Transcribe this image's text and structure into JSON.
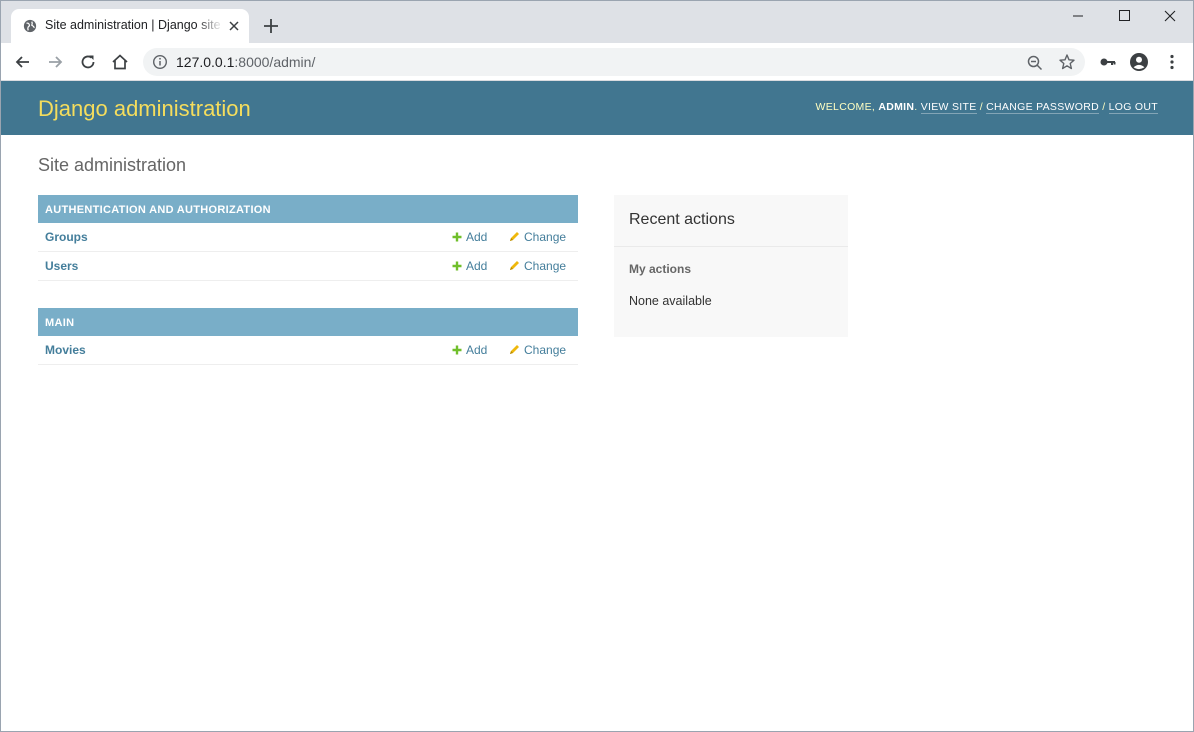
{
  "browser": {
    "tab_title": "Site administration | Django site admin",
    "url_host": "127.0.0.1",
    "url_rest": ":8000/admin/"
  },
  "header": {
    "branding": "Django administration",
    "welcome": "Welcome,",
    "username": "admin",
    "view_site": "View site",
    "change_password": "Change password",
    "log_out": "Log out",
    "sep": "/"
  },
  "content": {
    "title": "Site administration",
    "modules": [
      {
        "caption": "Authentication and Authorization",
        "models": [
          {
            "name": "Groups",
            "add": "Add",
            "change": "Change"
          },
          {
            "name": "Users",
            "add": "Add",
            "change": "Change"
          }
        ]
      },
      {
        "caption": "Main",
        "models": [
          {
            "name": "Movies",
            "add": "Add",
            "change": "Change"
          }
        ]
      }
    ]
  },
  "sidebar": {
    "title": "Recent actions",
    "subtitle": "My actions",
    "empty": "None available"
  },
  "colors": {
    "header_bg": "#417690",
    "branding": "#f5dd5d",
    "caption_bg": "#79aec8",
    "link": "#447e9b",
    "add_icon": "#70bf2b",
    "change_icon": "#efb80b"
  }
}
